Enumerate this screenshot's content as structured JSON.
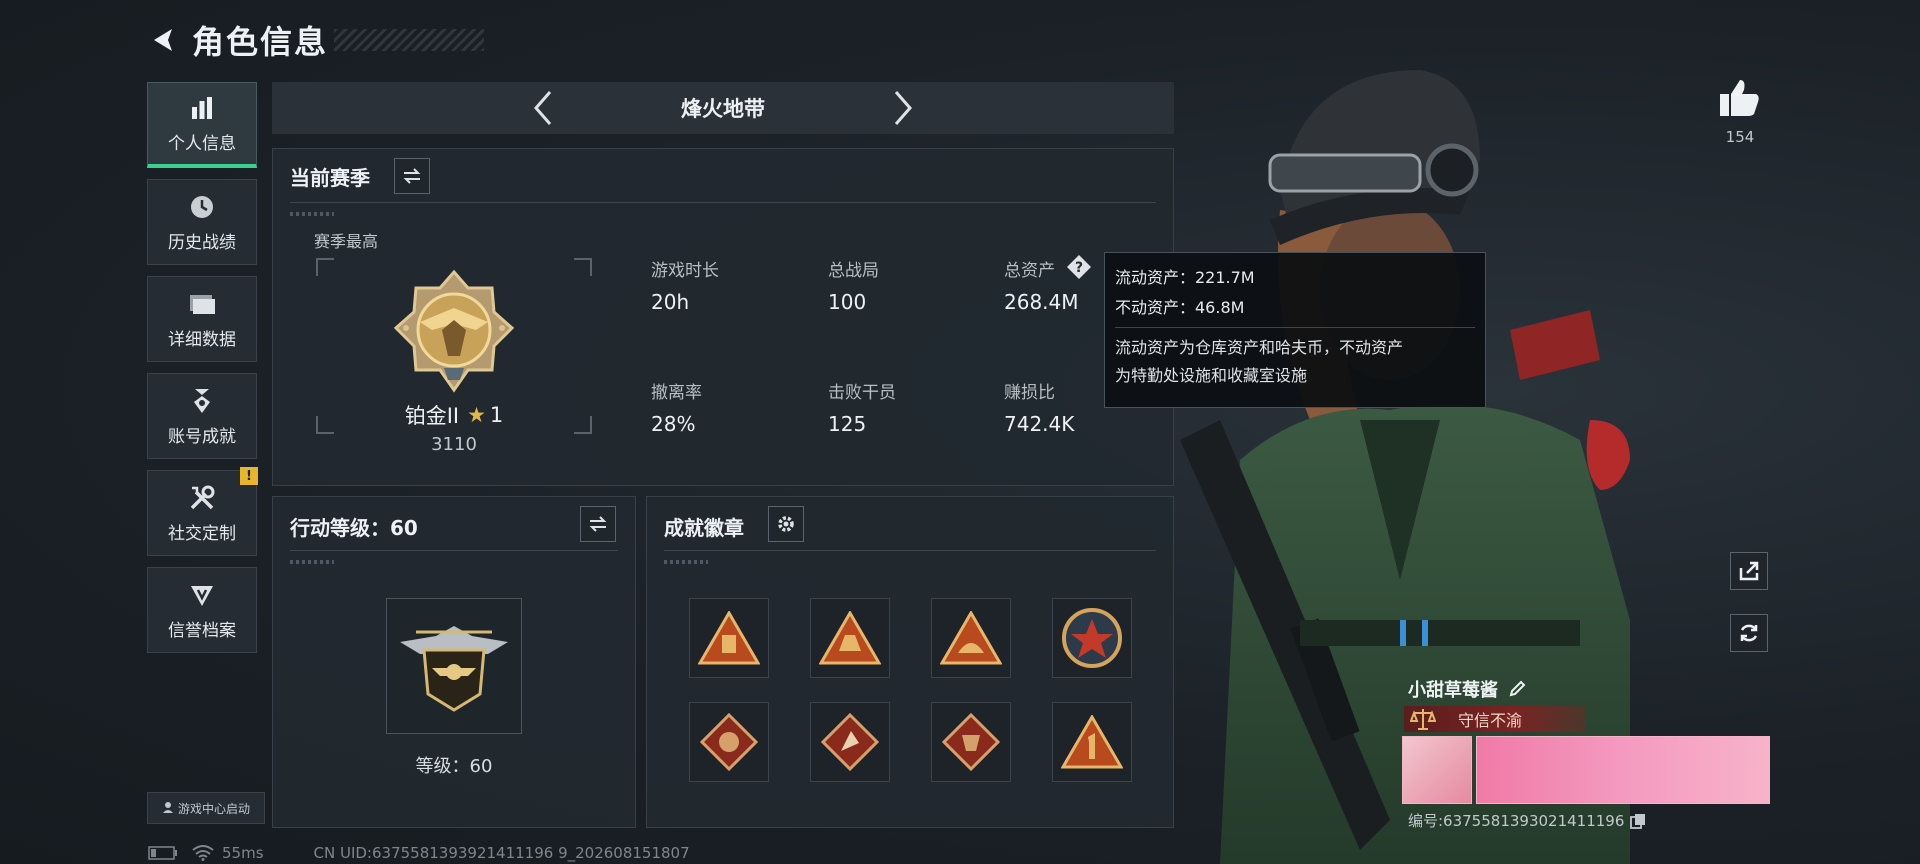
{
  "header": {
    "title": "角色信息"
  },
  "sidebar": {
    "items": [
      {
        "label": "个人信息",
        "icon": "bar-chart-icon",
        "active": true
      },
      {
        "label": "历史战绩",
        "icon": "clock-icon"
      },
      {
        "label": "详细数据",
        "icon": "folder-icon"
      },
      {
        "label": "账号成就",
        "icon": "medal-icon"
      },
      {
        "label": "社交定制",
        "icon": "tools-icon",
        "alert": "!"
      },
      {
        "label": "信誉档案",
        "icon": "shield-icon"
      }
    ],
    "game_center": "游戏中心启动"
  },
  "mode": {
    "name": "烽火地带"
  },
  "season": {
    "title": "当前赛季",
    "peak_label": "赛季最高",
    "rank_name": "铂金II",
    "rank_stars": "1",
    "rank_score": "3110",
    "stats": [
      {
        "label": "游戏时长",
        "value": "20h"
      },
      {
        "label": "总战局",
        "value": "100"
      },
      {
        "label": "总资产",
        "value": "268.4M"
      },
      {
        "label": "撤离率",
        "value": "28%"
      },
      {
        "label": "击败干员",
        "value": "125"
      },
      {
        "label": "赚损比",
        "value": "742.4K"
      }
    ]
  },
  "tooltip": {
    "liquid": "流动资产：221.7M",
    "fixed": "不动资产：46.8M",
    "desc_line1": "流动资产为仓库资产和哈夫币，不动资产",
    "desc_line2": "为特勤处设施和收藏室设施"
  },
  "level_panel": {
    "title": "行动等级：60",
    "level_text": "等级：60"
  },
  "achievement": {
    "title": "成就徽章"
  },
  "player": {
    "likes": "154",
    "name": "小甜草莓酱",
    "title_tag": "守信不渝",
    "id": "编号:6375581393021411196"
  },
  "status": {
    "ping": "55ms",
    "uid": "CN UID:6375581393921411196 9_202608151807"
  },
  "colors": {
    "accent": "#39d18f",
    "alert": "#e8b62a",
    "title_red": "#7a2323"
  }
}
